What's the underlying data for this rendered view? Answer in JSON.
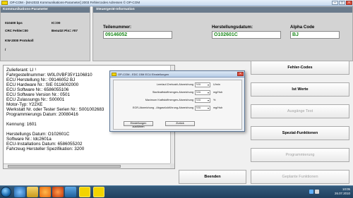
{
  "window": {
    "title": "OP-COM - [MA2033 Kommunikations-Parameter]   2003 Fehlercodes Adressen     © OP-COM",
    "buttons": [
      "–",
      "□",
      "×"
    ]
  },
  "kommunikation": {
    "title": "Kommunikations-Parameter",
    "baud": "010400 bps",
    "ic": "IC=00",
    "crc": "CRC Fehler=00",
    "benutzt": "Benutzt Pin= #07",
    "protokoll": "KW-2000 Protokoll",
    "slash": "/"
  },
  "steuergeraet": {
    "title": "Steuergerät-Information",
    "teilenummer_label": "Teilenummer:",
    "teilenummer_value": "09146052",
    "herstellungsdatum_label": "Herstellungsdatum:",
    "herstellungsdatum_value": "O102601C",
    "alpha_label": "Alpha Code",
    "alpha_value": "BJ"
  },
  "info_lines": [
    "Zulieferant: LI ¹",
    "Fahrgestellnummer: W0L0VBF35Y1106810",
    "ECU Herstellung Nr.: 09146052 BJ",
    "ECU Hardware Nr.: SIE  0116002000",
    "ECU Software Nr.: 6586055106",
    "ECU Software Version Nr.: 0501",
    "ECU Zulassungs Nr.: S00001",
    "Motor-Typ:  Y22XE",
    "Werkstatt Nr. oder Tester Serien Nr.: S001002683",
    "Programmierungs Datum: 20080416",
    "",
    "Kennung: 1601",
    "",
    "Herstellungs Datum: O102601C",
    "Software Nr.: ldc2601a",
    "ECU-Installations Datum: 6586055202",
    "Fahrzeug Hersteller Spezifikation: 3200"
  ],
  "sidebar": {
    "fehler_codes": "Fehler-Codes",
    "ist_werte": "Ist Werte",
    "ausgaenge_test": "Ausgänge Test",
    "spezial_funktionen": "Spezial-Funktionen",
    "programmierung": "Programmierung",
    "geplante_funktionen": "Geplante Funktionen",
    "beenden": "Beenden"
  },
  "dialog": {
    "title": "OP-COM - EDC 15M ECU Einstellungen",
    "close": "×",
    "rows": [
      {
        "label": "Leerlauf-Drehzahl-Abweichung",
        "value": "N/A",
        "unit": "U/min"
      },
      {
        "label": "Startkraftstoffmengen-Abweichung",
        "value": "N/A",
        "unit": "mg/Hub"
      },
      {
        "label": "Maximum Kraftstoffmengen-Abweichung",
        "value": "N/A",
        "unit": "%"
      },
      {
        "label": "EGR-Abweichung - Abgasrückführung-Abweichung",
        "value": "N/A",
        "unit": "mg/Hub"
      }
    ],
    "btn_einstellungen": "Einstellungen ausführen",
    "btn_zurueck": "Zurück"
  },
  "taskbar": {
    "time": "10:05",
    "date": "26.07.2010"
  },
  "colors": {
    "field_green": "#1c8a1c",
    "panel_head": "#6a7b8c",
    "desktop": "#1c5a8c"
  }
}
